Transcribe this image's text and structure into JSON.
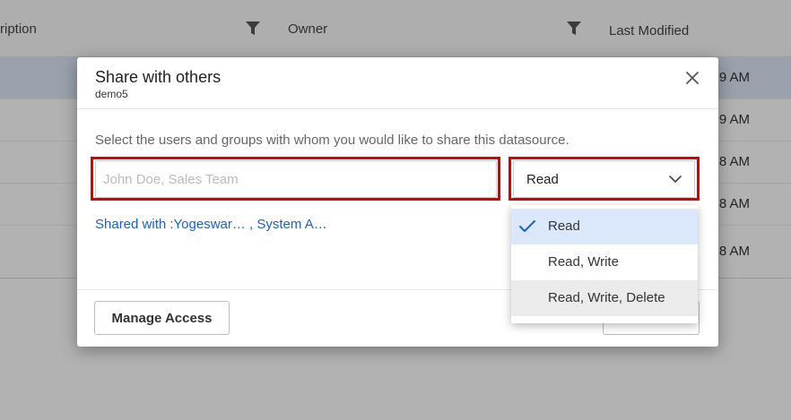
{
  "table": {
    "columns": [
      "ription",
      "Owner",
      "Last Modified"
    ],
    "filter_icon": "filter-icon",
    "time_suffixes": [
      "9 AM",
      "9 AM",
      "8 AM",
      "8 AM",
      "8 AM"
    ]
  },
  "dialog": {
    "title": "Share with others",
    "subtitle": "demo5",
    "close_icon": "close-icon",
    "description": "Select the users and groups with whom you would like to share this datasource.",
    "user_input": {
      "value": "",
      "placeholder": "John Doe, Sales Team"
    },
    "permission": {
      "value": "Read",
      "icon": "chevron-down-icon",
      "options": [
        "Read",
        "Read, Write",
        "Read, Write, Delete"
      ],
      "selected_option": "Read"
    },
    "shared_with": "Shared with :Yogeswar… , System A…",
    "manage_access_label": "Manage Access"
  },
  "colors": {
    "highlight": "#d80000",
    "link": "#1a5ed6",
    "selected_option_bg": "#dbe7fb",
    "selected_row_bg": "#dde7f7"
  }
}
